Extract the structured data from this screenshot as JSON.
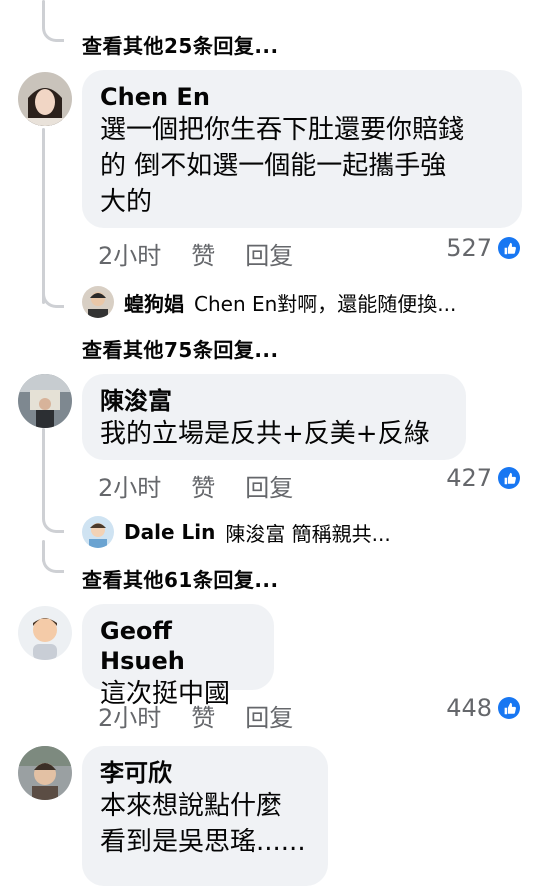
{
  "threads": [
    {
      "more_replies": "查看其他25条回复..."
    },
    {
      "name": "Chen En",
      "text_lines": [
        "選一個把你生吞下肚還要你賠錢",
        "的 倒不如選一個能一起攜手強",
        "大的"
      ],
      "time": "2小时",
      "like": "赞",
      "reply": "回复",
      "count": "527",
      "reply_preview": {
        "name": "蝗狗娼",
        "text": "Chen En對啊，還能随便換..."
      },
      "more_replies": "查看其他75条回复..."
    },
    {
      "name": "陳浚富",
      "text_lines": [
        "我的立場是反共+反美+反綠"
      ],
      "time": "2小时",
      "like": "赞",
      "reply": "回复",
      "count": "427",
      "reply_preview": {
        "name": "Dale Lin",
        "text": "陳浚富 簡稱親共..."
      },
      "more_replies": "查看其他61条回复..."
    },
    {
      "name": "Geoff Hsueh",
      "text_lines": [
        "這次挺中國"
      ],
      "time": "2小时",
      "like": "赞",
      "reply": "回复",
      "count": "448"
    },
    {
      "name": "李可欣",
      "text_lines": [
        "本來想說點什麼",
        "看到是吳思瑤......"
      ]
    }
  ],
  "colors": {
    "like_blue": "#1877f2",
    "bubble": "#f0f2f5",
    "meta_gray": "#65676b",
    "thread_line": "#ced0d4"
  },
  "icons": {
    "reaction": "thumbs-up-icon"
  }
}
